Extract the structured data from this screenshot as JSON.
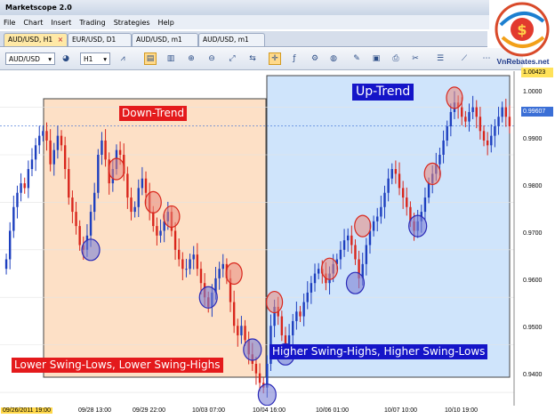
{
  "window": {
    "title": "Marketscope 2.0"
  },
  "menu": [
    "File",
    "Chart",
    "Insert",
    "Trading",
    "Strategies",
    "Help"
  ],
  "tabs": [
    {
      "label": "AUD/USD, H1",
      "active": true,
      "closable": true
    },
    {
      "label": "EUR/USD, D1",
      "active": false
    },
    {
      "label": "AUD/USD, m1",
      "active": false
    },
    {
      "label": "AUD/USD, m1",
      "active": false
    }
  ],
  "toolbar": {
    "symbol": "AUD/USD",
    "timeframe": "H1"
  },
  "logo": {
    "text": "VnRebates.net",
    "glyph": "$"
  },
  "annotations": {
    "downtrend_title": "Down-Trend",
    "uptrend_title": "Up-Trend",
    "downtrend_caption": "Lower Swing-Lows, Lower Swing-Highs",
    "uptrend_caption": "Higher Swing-Highs, Higher Swing-Lows"
  },
  "price_axis": {
    "ticks": [
      "1.0000",
      "0.9900",
      "0.9800",
      "0.9700",
      "0.9600",
      "0.9500",
      "0.9400"
    ],
    "high_marker": "1.00423",
    "last_price": "0.99607"
  },
  "time_axis": {
    "ticks": [
      "09/26/2011 19:00",
      "09/28 13:00",
      "09/29 22:00",
      "10/03 07:00",
      "10/04 16:00",
      "10/06 01:00",
      "10/07 10:00",
      "10/10 19:00"
    ]
  },
  "colors": {
    "downtrend_zone": "#fde0c6",
    "uptrend_zone": "#cfe4fb",
    "downtrend_label_bg": "#e41a1c",
    "uptrend_label_bg": "#1515c8",
    "bull_candle": "#1d3fbf",
    "bear_candle": "#d9261c",
    "swing_high_circle": "#e8897e",
    "swing_low_circle": "#7b80d6"
  },
  "chart_data": {
    "type": "candlestick",
    "instrument": "AUD/USD",
    "timeframe": "H1",
    "ylim": [
      0.9372,
      1.0076
    ],
    "x_ticks": [
      "09/26/2011 19:00",
      "09/28 13:00",
      "09/29 22:00",
      "10/03 07:00",
      "10/04 16:00",
      "10/06 01:00",
      "10/07 10:00",
      "10/10 19:00"
    ],
    "path_closes": [
      0.968,
      0.974,
      0.979,
      0.982,
      0.984,
      0.983,
      0.987,
      0.989,
      0.992,
      0.994,
      0.995,
      0.993,
      0.988,
      0.991,
      0.994,
      0.992,
      0.987,
      0.981,
      0.978,
      0.975,
      0.971,
      0.97,
      0.973,
      0.978,
      0.982,
      0.99,
      0.993,
      0.989,
      0.984,
      0.987,
      0.991,
      0.99,
      0.986,
      0.981,
      0.978,
      0.979,
      0.983,
      0.985,
      0.982,
      0.978,
      0.975,
      0.973,
      0.974,
      0.976,
      0.978,
      0.974,
      0.97,
      0.968,
      0.966,
      0.966,
      0.968,
      0.969,
      0.966,
      0.963,
      0.96,
      0.958,
      0.961,
      0.964,
      0.966,
      0.967,
      0.964,
      0.959,
      0.954,
      0.952,
      0.954,
      0.951,
      0.948,
      0.946,
      0.944,
      0.942,
      0.941,
      0.946,
      0.954,
      0.958,
      0.956,
      0.952,
      0.95,
      0.952,
      0.955,
      0.957,
      0.956,
      0.959,
      0.961,
      0.963,
      0.965,
      0.966,
      0.965,
      0.963,
      0.965,
      0.967,
      0.968,
      0.97,
      0.972,
      0.973,
      0.971,
      0.968,
      0.964,
      0.967,
      0.971,
      0.974,
      0.976,
      0.977,
      0.979,
      0.982,
      0.985,
      0.987,
      0.986,
      0.983,
      0.981,
      0.979,
      0.976,
      0.974,
      0.976,
      0.978,
      0.981,
      0.984,
      0.986,
      0.988,
      0.99,
      0.993,
      0.996,
      0.999,
      1.001,
      1.0,
      0.998,
      0.997,
      0.999,
      1.0,
      0.998,
      0.995,
      0.993,
      0.992,
      0.994,
      0.996,
      0.998,
      1.0,
      0.998,
      0.996
    ],
    "swing_highs": [
      0.987,
      0.98,
      0.977,
      0.965,
      0.959,
      0.975,
      0.966,
      0.986,
      1.002
    ],
    "swing_lows": [
      0.97,
      0.96,
      0.949,
      0.9395,
      0.948,
      0.963,
      0.975
    ],
    "last_price": 0.99607,
    "session_high": 1.00423
  }
}
